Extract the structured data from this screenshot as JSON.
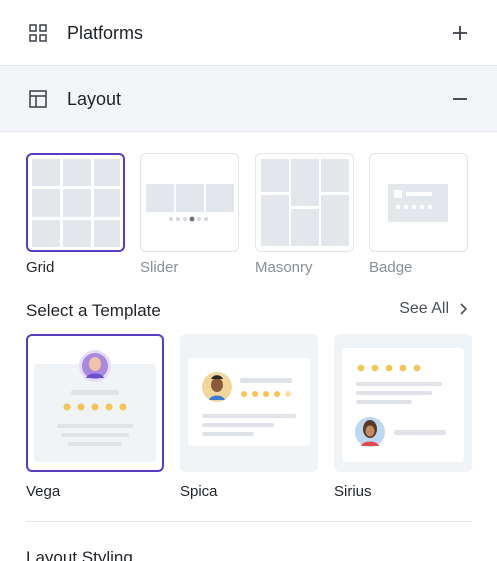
{
  "platforms": {
    "title": "Platforms",
    "icon": "grid-icon",
    "action_icon": "plus-icon"
  },
  "layout": {
    "title": "Layout",
    "icon": "layout-icon",
    "action_icon": "minus-icon"
  },
  "layout_options": [
    {
      "label": "Grid",
      "selected": true
    },
    {
      "label": "Slider",
      "selected": false
    },
    {
      "label": "Masonry",
      "selected": false
    },
    {
      "label": "Badge",
      "selected": false
    }
  ],
  "templates_section": {
    "title": "Select a Template",
    "see_all": "See All"
  },
  "templates": [
    {
      "name": "Vega",
      "selected": true
    },
    {
      "name": "Spica",
      "selected": false
    },
    {
      "name": "Sirius",
      "selected": false
    }
  ],
  "layout_styling": {
    "title": "Layout Styling"
  },
  "colors": {
    "accent": "#5b3bc4",
    "star": "#f5c451",
    "tile": "#e3e6ea",
    "panel": "#f1f4f7"
  }
}
